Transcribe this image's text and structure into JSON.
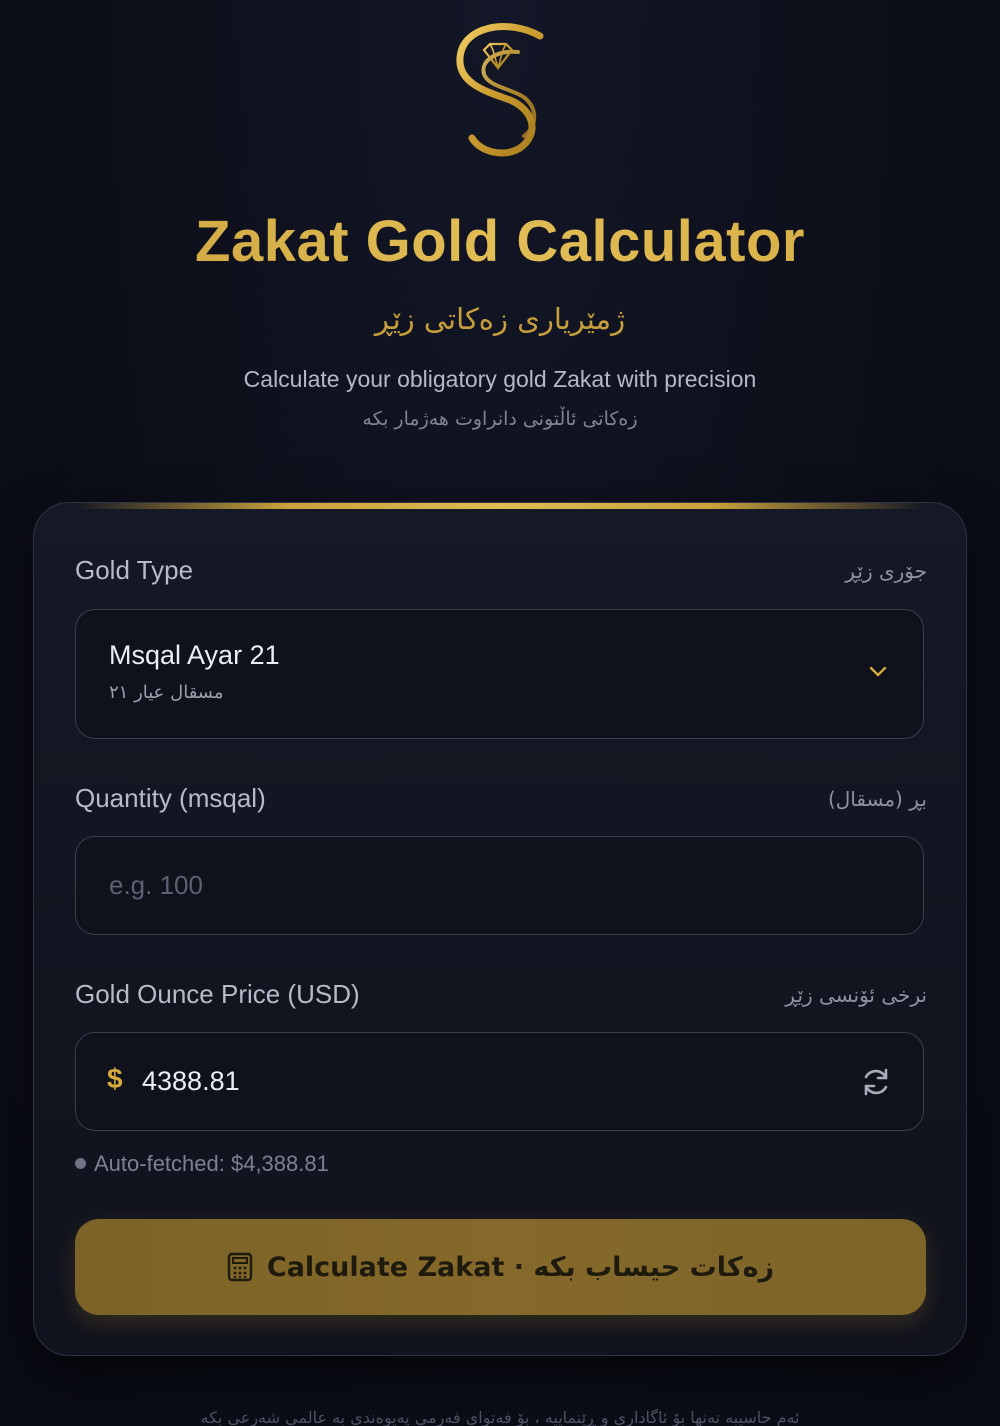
{
  "header": {
    "logo_icon": "diamond-s-logo-icon",
    "title": "Zakat Gold Calculator",
    "subtitle_ku": "ژمێریاری زەکاتی زێڕ",
    "tagline_en": "Calculate your obligatory gold Zakat with precision",
    "tagline_ku": "زەکاتی ئاڵتونی دانراوت هەژمار بکە"
  },
  "form": {
    "gold_type": {
      "label_en": "Gold Type",
      "label_ku": "جۆری زێڕ",
      "selected_en": "Msqal Ayar 21",
      "selected_ku": "مسقال عيار ٢١",
      "icon": "chevron-down-icon"
    },
    "quantity": {
      "label_en": "Quantity (msqal)",
      "label_ku": "بڕ (مسقال)",
      "value": "",
      "placeholder": "e.g. 100"
    },
    "ounce_price": {
      "label_en": "Gold Ounce Price (USD)",
      "label_ku": "نرخی ئۆنسی زێڕ",
      "currency_symbol": "$",
      "value": "4388.81",
      "icon": "refresh-icon",
      "hint": "Auto-fetched: $4,388.81"
    },
    "submit": {
      "icon": "calculator-icon",
      "label": "Calculate Zakat · زەکات حیساب بکە"
    }
  },
  "footer": {
    "note": "ئەم حاسیبە تەنها بۆ ئاگاداری و ڕێنماییە ، بۆ فەتوای فەرمی پەیوەندی بە عالمی شەرعی بکە"
  },
  "colors": {
    "background": "#0d0f1a",
    "accent_gold": "#d6ab3e",
    "button_gold": "#85692a",
    "card_bg": "#141724",
    "field_border": "#3a3e4f"
  }
}
